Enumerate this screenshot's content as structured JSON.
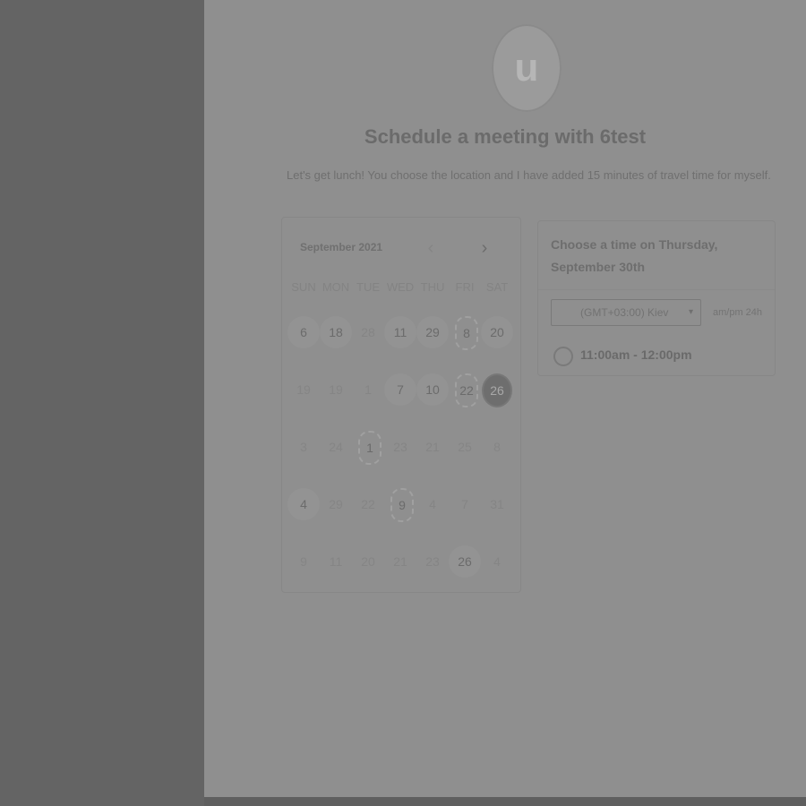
{
  "profile": {
    "avatar_letter": "u"
  },
  "header": {
    "title": "Schedule a meeting with 6test",
    "description": "Let's get lunch! You choose the location and I have added 15 minutes of travel time for myself."
  },
  "calendar": {
    "month_label": "September 2021",
    "weekdays": [
      "SUN",
      "MON",
      "TUE",
      "WED",
      "THU",
      "FRI",
      "SAT"
    ],
    "weeks": [
      [
        {
          "d": "6",
          "e": true,
          "p": true
        },
        {
          "d": "18",
          "e": true,
          "p": true
        },
        {
          "d": "28",
          "e": false
        },
        {
          "d": "11",
          "e": true,
          "p": true
        },
        {
          "d": "29",
          "e": true,
          "p": true
        },
        {
          "d": "8",
          "e": true,
          "r": true
        },
        {
          "d": "20",
          "e": true,
          "p": true
        }
      ],
      [
        {
          "d": "19",
          "e": false
        },
        {
          "d": "19",
          "e": false
        },
        {
          "d": "1",
          "e": false
        },
        {
          "d": "7",
          "e": true,
          "p": true
        },
        {
          "d": "10",
          "e": true,
          "p": true
        },
        {
          "d": "22",
          "e": true,
          "r": true
        },
        {
          "d": "26",
          "e": true,
          "s": true
        }
      ],
      [
        {
          "d": "3",
          "e": false
        },
        {
          "d": "24",
          "e": false
        },
        {
          "d": "1",
          "e": true,
          "r": true
        },
        {
          "d": "23",
          "e": false
        },
        {
          "d": "21",
          "e": false
        },
        {
          "d": "25",
          "e": false
        },
        {
          "d": "8",
          "e": false
        }
      ],
      [
        {
          "d": "4",
          "e": true,
          "p": true
        },
        {
          "d": "29",
          "e": false
        },
        {
          "d": "22",
          "e": false
        },
        {
          "d": "9",
          "e": true,
          "r": true
        },
        {
          "d": "4",
          "e": false
        },
        {
          "d": "7",
          "e": false
        },
        {
          "d": "31",
          "e": false
        }
      ],
      [
        {
          "d": "9",
          "e": false
        },
        {
          "d": "11",
          "e": false
        },
        {
          "d": "20",
          "e": false
        },
        {
          "d": "21",
          "e": false
        },
        {
          "d": "23",
          "e": false
        },
        {
          "d": "26",
          "e": true,
          "p": true
        },
        {
          "d": "4",
          "e": false
        }
      ]
    ],
    "prev_icon": "chevron-left-icon",
    "next_icon": "chevron-right-icon"
  },
  "time_panel": {
    "heading": "Choose a time on Thursday, September 30th",
    "timezone": "(GMT+03:00) Kiev",
    "format_toggle": "am/pm  24h",
    "slots": [
      "11:00am - 12:00pm"
    ]
  }
}
